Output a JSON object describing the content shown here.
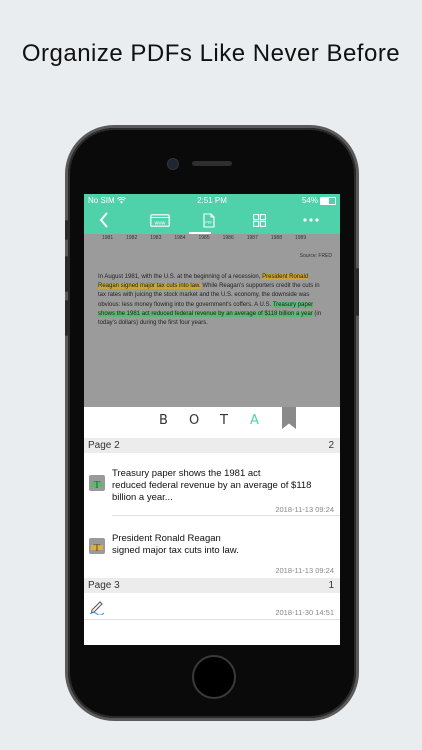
{
  "headline": "Organize PDFs Like Never Before",
  "status": {
    "carrier": "No SIM",
    "time": "2:51 PM",
    "battery": "54%",
    "battery_level": 0.54
  },
  "toolbar": {
    "items": [
      {
        "name": "back",
        "icon": "chevron-left-icon"
      },
      {
        "name": "web",
        "icon": "www-icon",
        "label": "www"
      },
      {
        "name": "pdf",
        "icon": "pdf-file-icon",
        "label": "PDF"
      },
      {
        "name": "grid",
        "icon": "grid-icon"
      },
      {
        "name": "more",
        "icon": "more-icon"
      }
    ]
  },
  "pdf": {
    "years": [
      "1981",
      "1982",
      "1983",
      "1984",
      "1985",
      "1986",
      "1987",
      "1988",
      "1989"
    ],
    "source": "Source: FRED",
    "text_1": "In August 1981, with the U.S. at the beginning of a recession, ",
    "highlight_1": "President Ronald Reagan signed major tax cuts into law.",
    "text_2": " While Reagan's supporters credit the cuts in tax rates with juicing the stock market and the U.S. economy, the downside was obvious: less money flowing into the government's coffers. A U.S. ",
    "highlight_2": "Treasury paper shows the 1981 act reduced federal revenue by an average of $118 billion a year",
    "text_3": " (in today's dollars) during the first four years."
  },
  "tabs": {
    "b": "B",
    "o": "O",
    "t": "T",
    "a": "A"
  },
  "sections": [
    {
      "title": "Page 2",
      "count": "2",
      "items": [
        {
          "icon_glyph": "T",
          "text_l1": "Treasury paper shows the 1981 act",
          "text_l2": "reduced federal revenue by an average of $118",
          "text_l3": "billion a year...",
          "date": "2018-11-13 09:24"
        },
        {
          "icon_glyph": "T",
          "text_l1": "President Ronald Reagan",
          "text_l2": "signed major tax cuts into law.",
          "date": "2018-11-13 09:24"
        }
      ]
    },
    {
      "title": "Page 3",
      "count": "1",
      "items": [
        {
          "icon": "pen-icon",
          "date": "2018-11-30 14:51"
        }
      ]
    }
  ]
}
